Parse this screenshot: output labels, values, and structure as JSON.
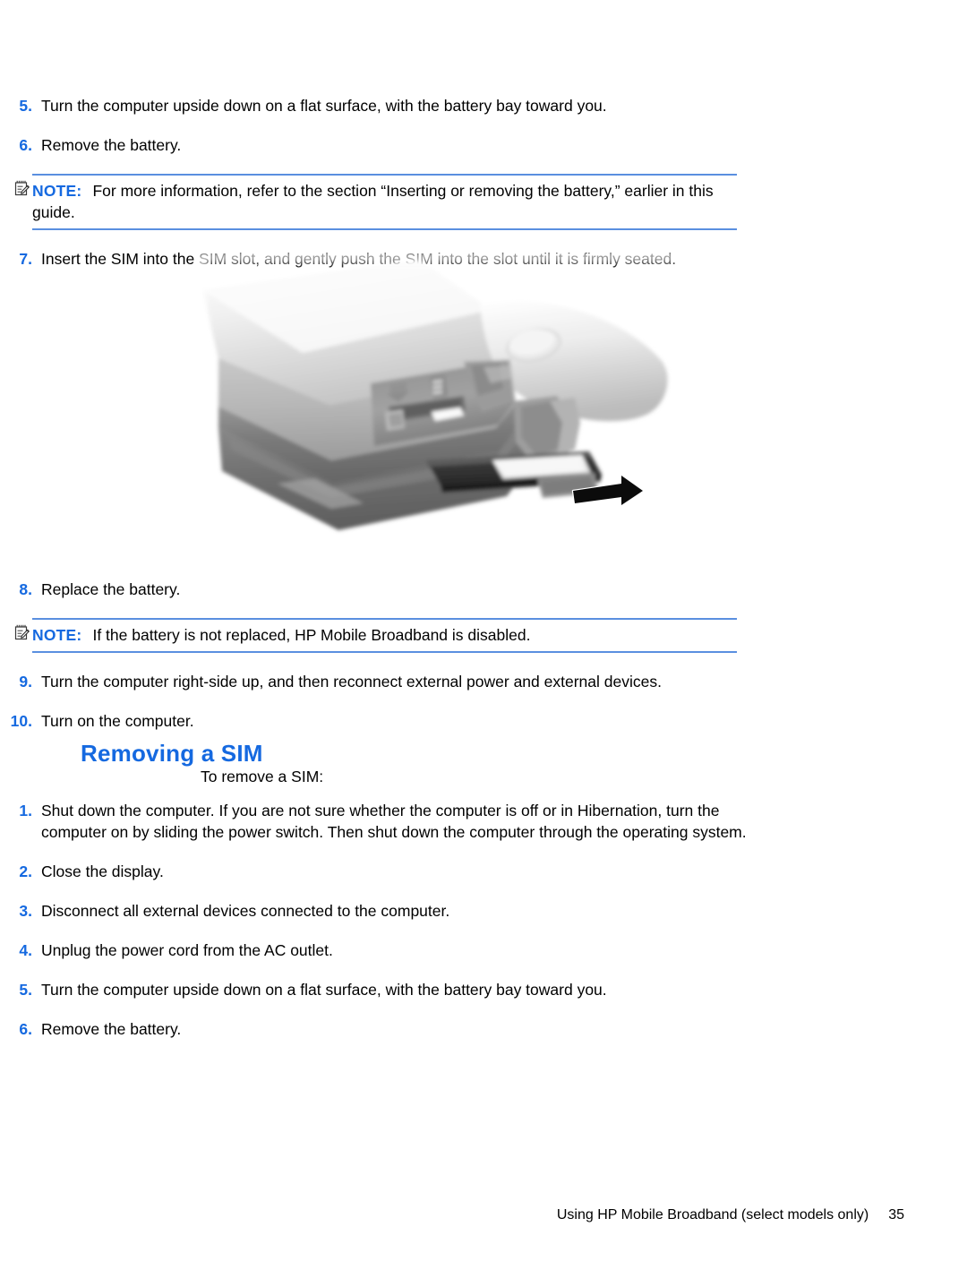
{
  "document": {
    "section_heading": "Removing a SIM",
    "intro_line": "To remove a SIM:",
    "footer_text": "Using HP Mobile Broadband (select models only)",
    "footer_page_number": "35",
    "accent_blue": "#1569e0",
    "rule_blue": "#5a8fe0"
  },
  "inserting_steps": [
    {
      "number": "5.",
      "text": "Turn the computer upside down on a flat surface, with the battery bay toward you."
    },
    {
      "number": "6.",
      "text": "Remove the battery."
    },
    {
      "number": "7.",
      "text": "Insert the SIM into the SIM slot, and gently push the SIM into the slot until it is firmly seated."
    },
    {
      "number": "8.",
      "text": "Replace the battery."
    },
    {
      "number": "9.",
      "text": "Turn the computer right-side up, and then reconnect external power and external devices."
    },
    {
      "number": "10.",
      "text": "Turn on the computer."
    }
  ],
  "notes": [
    {
      "icon": "note-pad-icon",
      "label": "NOTE:",
      "text": "For more information, refer to the section “Inserting or removing the battery,” earlier in this guide."
    },
    {
      "icon": "note-pad-icon",
      "label": "NOTE:",
      "text": "If the battery is not replaced, HP Mobile Broadband is disabled."
    }
  ],
  "removing_steps": [
    {
      "number": "1.",
      "text": "Shut down the computer. If you are not sure whether the computer is off or in Hibernation, turn the computer on by sliding the power switch. Then shut down the computer through the operating system."
    },
    {
      "number": "2.",
      "text": "Close the display."
    },
    {
      "number": "3.",
      "text": "Disconnect all external devices connected to the computer."
    },
    {
      "number": "4.",
      "text": "Unplug the power cord from the AC outlet."
    },
    {
      "number": "5.",
      "text": "Turn the computer upside down on a flat surface, with the battery bay toward you."
    },
    {
      "number": "6.",
      "text": "Remove the battery."
    }
  ],
  "figure": {
    "name": "laptop-sim-slot-photo",
    "caption": "Grayscale photograph of an inverted notebook computer with a SIM card being inserted into the SIM slot inside the battery bay; a black arrow indicates the push direction."
  }
}
